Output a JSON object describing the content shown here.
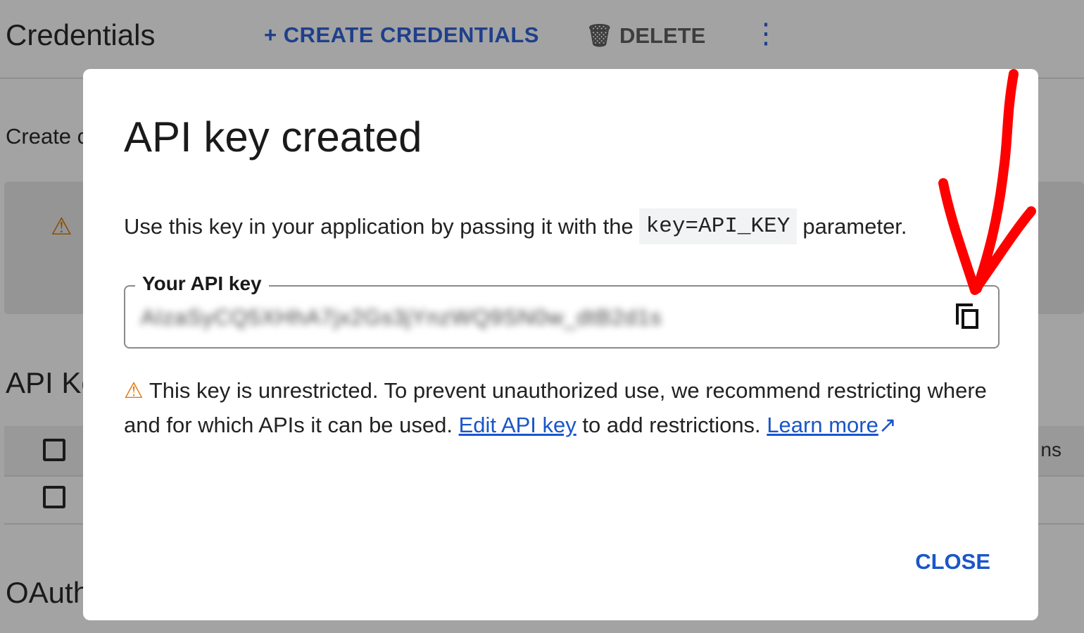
{
  "page": {
    "title": "Credentials",
    "create_label": "CREATE CREDENTIALS",
    "delete_label": "DELETE",
    "create_partial": "Create c",
    "api_keys_partial": "API Ke",
    "oauth_partial": "OAuth",
    "column_partial": "ns"
  },
  "dialog": {
    "title": "API key created",
    "desc_before": "Use this key in your application by passing it with the",
    "desc_code": "key=API_KEY",
    "desc_after": "parameter.",
    "field_label": "Your API key",
    "field_value": "AIzaSyCQ5XHhA7jx2Gs3jYnzWQ9SN0w_dtB2d1s",
    "warning_text": "This key is unrestricted. To prevent unauthorized use, we recommend restricting where and for which APIs it can be used.",
    "edit_link": "Edit API key",
    "middle_text": "to add restrictions.",
    "learn_more": "Learn more",
    "close_label": "CLOSE"
  },
  "colors": {
    "accent": "#1a56c9",
    "warning": "#e37400",
    "annotation": "#ff0000"
  }
}
